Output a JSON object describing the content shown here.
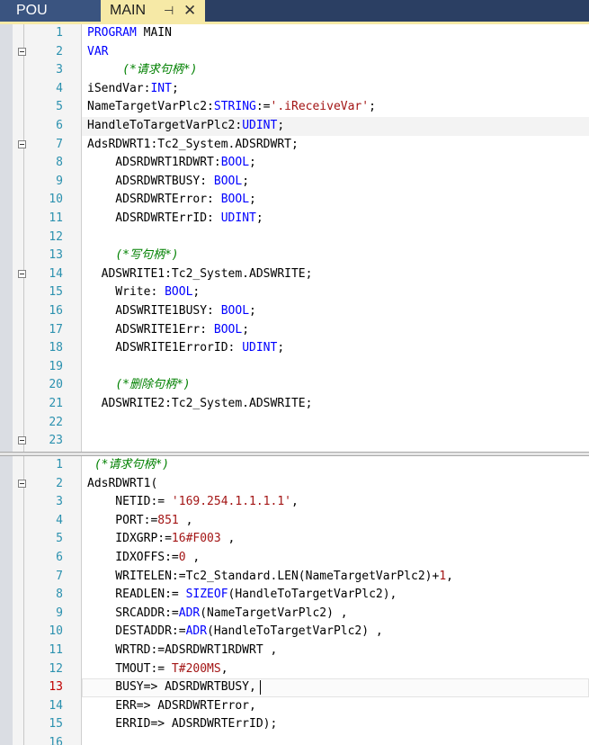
{
  "tabs": {
    "pou_label": "POU",
    "main_label": "MAIN",
    "pin_glyph": "⊣",
    "close_glyph": "✕"
  },
  "top_editor": {
    "lines": [
      {
        "num": "1",
        "segs": [
          [
            "kw",
            "PROGRAM"
          ],
          [
            "tx",
            " MAIN"
          ]
        ]
      },
      {
        "num": "2",
        "fold": true,
        "segs": [
          [
            "kw",
            "VAR"
          ]
        ]
      },
      {
        "num": "3",
        "segs": [
          [
            "tx",
            "     "
          ],
          [
            "cm",
            "(*请求句柄*)"
          ]
        ]
      },
      {
        "num": "4",
        "segs": [
          [
            "tx",
            "iSendVar:"
          ],
          [
            "kw",
            "INT"
          ],
          [
            "tx",
            ";"
          ]
        ]
      },
      {
        "num": "5",
        "segs": [
          [
            "tx",
            "NameTargetVarPlc2:"
          ],
          [
            "kw",
            "STRING"
          ],
          [
            "tx",
            ":="
          ],
          [
            "str",
            "'.iReceiveVar'"
          ],
          [
            "tx",
            ";"
          ]
        ]
      },
      {
        "num": "6",
        "segs": [
          [
            "tx",
            "HandleToTargetVarPlc2:"
          ],
          [
            "kw",
            "UDINT"
          ],
          [
            "tx",
            ";"
          ]
        ]
      },
      {
        "num": "7",
        "fold": true,
        "segs": [
          [
            "tx",
            "AdsRDWRT1:Tc2_System.ADSRDWRT;"
          ]
        ]
      },
      {
        "num": "8",
        "segs": [
          [
            "tx",
            "    ADSRDWRT1RDWRT:"
          ],
          [
            "kw",
            "BOOL"
          ],
          [
            "tx",
            ";"
          ]
        ]
      },
      {
        "num": "9",
        "segs": [
          [
            "tx",
            "    ADSRDWRTBUSY: "
          ],
          [
            "kw",
            "BOOL"
          ],
          [
            "tx",
            ";"
          ]
        ]
      },
      {
        "num": "10",
        "segs": [
          [
            "tx",
            "    ADSRDWRTError: "
          ],
          [
            "kw",
            "BOOL"
          ],
          [
            "tx",
            ";"
          ]
        ]
      },
      {
        "num": "11",
        "segs": [
          [
            "tx",
            "    ADSRDWRTErrID: "
          ],
          [
            "kw",
            "UDINT"
          ],
          [
            "tx",
            ";"
          ]
        ]
      },
      {
        "num": "12",
        "segs": []
      },
      {
        "num": "13",
        "segs": [
          [
            "tx",
            "    "
          ],
          [
            "cm",
            "(*写句柄*)"
          ]
        ]
      },
      {
        "num": "14",
        "fold": true,
        "segs": [
          [
            "tx",
            "  ADSWRITE1:Tc2_System.ADSWRITE;"
          ]
        ]
      },
      {
        "num": "15",
        "segs": [
          [
            "tx",
            "    Write: "
          ],
          [
            "kw",
            "BOOL"
          ],
          [
            "tx",
            ";"
          ]
        ]
      },
      {
        "num": "16",
        "segs": [
          [
            "tx",
            "    ADSWRITE1BUSY: "
          ],
          [
            "kw",
            "BOOL"
          ],
          [
            "tx",
            ";"
          ]
        ]
      },
      {
        "num": "17",
        "segs": [
          [
            "tx",
            "    ADSWRITE1Err: "
          ],
          [
            "kw",
            "BOOL"
          ],
          [
            "tx",
            ";"
          ]
        ]
      },
      {
        "num": "18",
        "segs": [
          [
            "tx",
            "    ADSWRITE1ErrorID: "
          ],
          [
            "kw",
            "UDINT"
          ],
          [
            "tx",
            ";"
          ]
        ]
      },
      {
        "num": "19",
        "segs": []
      },
      {
        "num": "20",
        "segs": [
          [
            "tx",
            "    "
          ],
          [
            "cm",
            "(*删除句柄*)"
          ]
        ]
      },
      {
        "num": "21",
        "segs": [
          [
            "tx",
            "  ADSWRITE2:Tc2_System.ADSWRITE;"
          ]
        ]
      },
      {
        "num": "22",
        "segs": []
      },
      {
        "num": "23",
        "fold": true,
        "segs": []
      }
    ]
  },
  "bottom_editor": {
    "lines": [
      {
        "num": "1",
        "segs": [
          [
            "cm",
            " (*请求句柄*)"
          ]
        ]
      },
      {
        "num": "2",
        "fold": true,
        "segs": [
          [
            "tx",
            "AdsRDWRT1("
          ]
        ]
      },
      {
        "num": "3",
        "segs": [
          [
            "tx",
            "    NETID:= "
          ],
          [
            "str",
            "'169.254.1.1.1.1'"
          ],
          [
            "tx",
            ","
          ]
        ]
      },
      {
        "num": "4",
        "segs": [
          [
            "tx",
            "    PORT:="
          ],
          [
            "str",
            "851"
          ],
          [
            "tx",
            " ,"
          ]
        ]
      },
      {
        "num": "5",
        "segs": [
          [
            "tx",
            "    IDXGRP:="
          ],
          [
            "str",
            "16#F003"
          ],
          [
            "tx",
            " ,"
          ]
        ]
      },
      {
        "num": "6",
        "segs": [
          [
            "tx",
            "    IDXOFFS:="
          ],
          [
            "str",
            "0"
          ],
          [
            "tx",
            " ,"
          ]
        ]
      },
      {
        "num": "7",
        "segs": [
          [
            "tx",
            "    WRITELEN:=Tc2_Standard.LEN(NameTargetVarPlc2)+"
          ],
          [
            "str",
            "1"
          ],
          [
            "tx",
            ","
          ]
        ]
      },
      {
        "num": "8",
        "segs": [
          [
            "tx",
            "    READLEN:= "
          ],
          [
            "kw",
            "SIZEOF"
          ],
          [
            "tx",
            "(HandleToTargetVarPlc2),"
          ]
        ]
      },
      {
        "num": "9",
        "segs": [
          [
            "tx",
            "    SRCADDR:="
          ],
          [
            "kw",
            "ADR"
          ],
          [
            "tx",
            "(NameTargetVarPlc2) ,"
          ]
        ]
      },
      {
        "num": "10",
        "segs": [
          [
            "tx",
            "    DESTADDR:="
          ],
          [
            "kw",
            "ADR"
          ],
          [
            "tx",
            "(HandleToTargetVarPlc2) ,"
          ]
        ]
      },
      {
        "num": "11",
        "segs": [
          [
            "tx",
            "    WRTRD:=ADSRDWRT1RDWRT ,"
          ]
        ]
      },
      {
        "num": "12",
        "segs": [
          [
            "tx",
            "    TMOUT:= "
          ],
          [
            "str",
            "T#200MS"
          ],
          [
            "tx",
            ","
          ]
        ]
      },
      {
        "num": "13",
        "red": true,
        "caret": true,
        "segs": [
          [
            "tx",
            "    BUSY=> ADSRDWRTBUSY,"
          ]
        ]
      },
      {
        "num": "14",
        "segs": [
          [
            "tx",
            "    ERR=> ADSRDWRTError,"
          ]
        ]
      },
      {
        "num": "15",
        "segs": [
          [
            "tx",
            "    ERRID=> ADSRDWRTErrID);"
          ]
        ]
      },
      {
        "num": "16",
        "segs": []
      }
    ]
  },
  "colors": {
    "keyword": "#0000ff",
    "comment": "#008000",
    "literal": "#a31515",
    "line_number": "#2b91af",
    "current_line_number": "#c00000",
    "tab_active": "#f6e9a6",
    "tabbar": "#2b3f63"
  }
}
